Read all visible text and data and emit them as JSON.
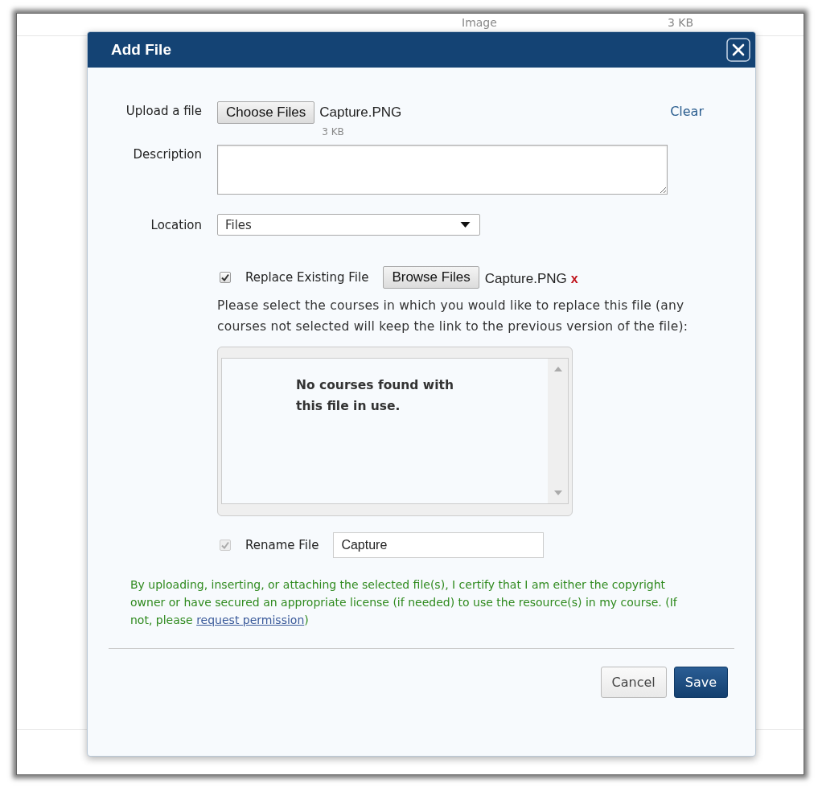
{
  "background_row": {
    "type": "Image",
    "size": "3 KB"
  },
  "dialog": {
    "title": "Add File",
    "upload": {
      "label": "Upload a file",
      "button": "Choose Files",
      "file_name": "Capture.PNG",
      "file_size": "3 KB",
      "clear": "Clear"
    },
    "description": {
      "label": "Description"
    },
    "location": {
      "label": "Location",
      "value": "Files"
    },
    "replace": {
      "label": "Replace Existing File",
      "checked": true,
      "button": "Browse Files",
      "file_name": "Capture.PNG",
      "remove": "x",
      "instructions": "Please select the courses in which you would like to replace this file (any courses not selected will keep the link to the previous version of the file):",
      "courses_message": "No courses found with this file in use."
    },
    "rename": {
      "label": "Rename File",
      "checked": true,
      "disabled": true,
      "value": "Capture"
    },
    "disclaimer": {
      "text": "By uploading, inserting, or attaching the selected file(s), I certify that I am either the copyright owner or have secured an appropriate license (if needed) to use the resource(s) in my course. (If not, please ",
      "link": "request permission",
      "after": ")"
    },
    "buttons": [
      {
        "label": "Cancel",
        "kind": "secondary"
      },
      {
        "label": "Save",
        "kind": "primary"
      }
    ]
  }
}
